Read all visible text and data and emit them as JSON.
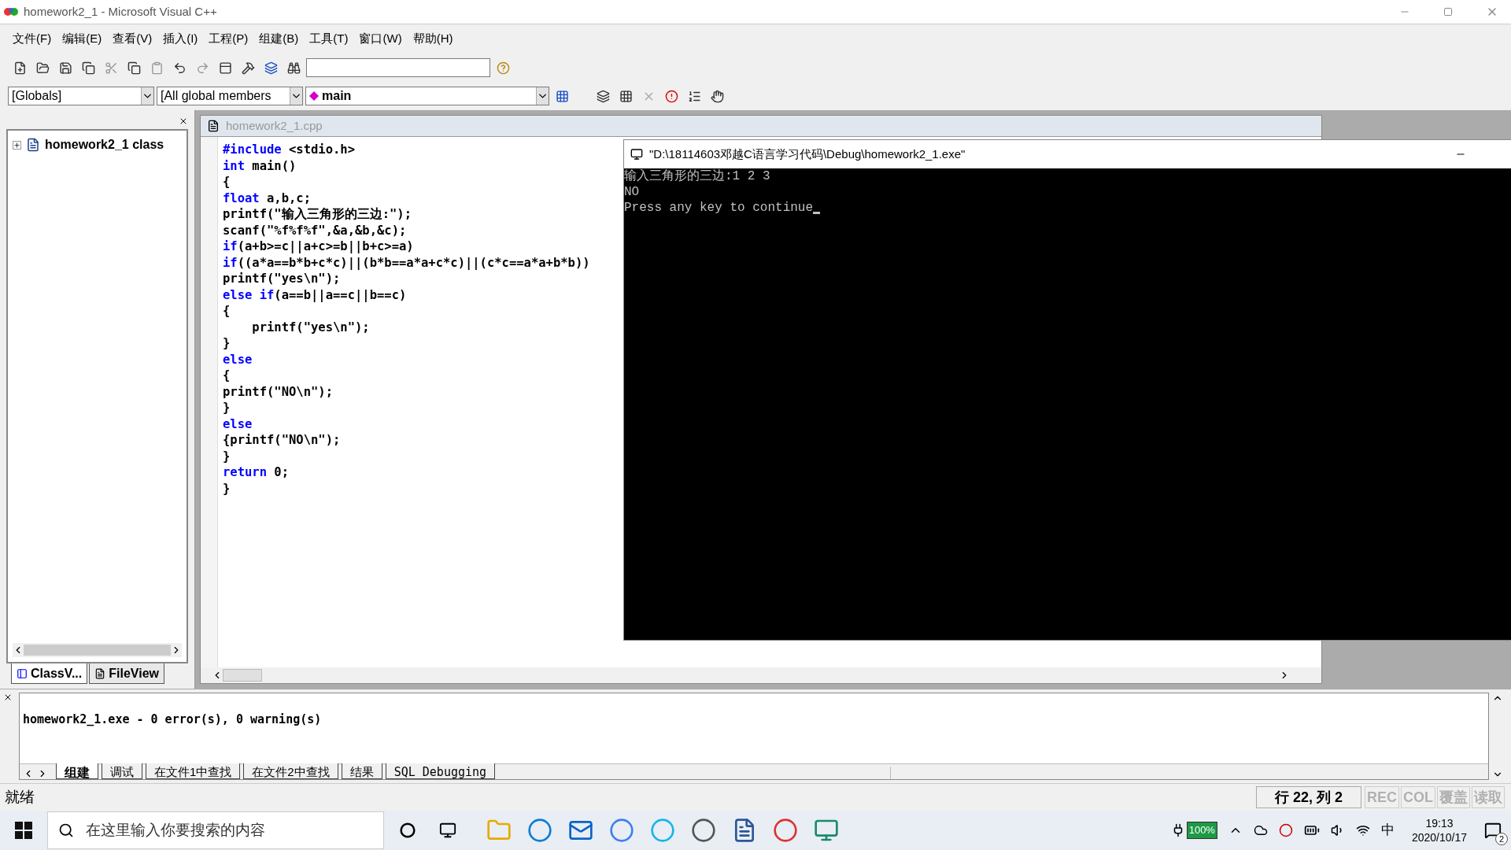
{
  "window": {
    "title": "homework2_1 - Microsoft Visual C++"
  },
  "menu": [
    "文件(F)",
    "编辑(E)",
    "查看(V)",
    "插入(I)",
    "工程(P)",
    "组建(B)",
    "工具(T)",
    "窗口(W)",
    "帮助(H)"
  ],
  "wizard_bar": {
    "class_combo": "[Globals]",
    "filter_combo": "[All global members",
    "member_combo": "main"
  },
  "workspace": {
    "tree": [
      {
        "label": "homework2_1 class",
        "expanded": false
      }
    ],
    "tabs": [
      {
        "label": "ClassV...",
        "selected": true
      },
      {
        "label": "FileView",
        "selected": false
      }
    ]
  },
  "editor": {
    "title": "homework2_1.cpp",
    "lines": [
      [
        {
          "kind": "keyword",
          "text": "#include"
        },
        {
          "kind": "plain",
          "text": " <stdio.h>"
        }
      ],
      [
        {
          "kind": "keyword",
          "text": "int"
        },
        {
          "kind": "plain",
          "text": " main()"
        }
      ],
      [
        {
          "kind": "plain",
          "text": "{"
        }
      ],
      [
        {
          "kind": "keyword",
          "text": "float"
        },
        {
          "kind": "plain",
          "text": " a,b,c;"
        }
      ],
      [
        {
          "kind": "plain",
          "text": "printf(\"输入三角形的三边:\");"
        }
      ],
      [
        {
          "kind": "plain",
          "text": "scanf(\"%f%f%f\",&a,&b,&c);"
        }
      ],
      [
        {
          "kind": "keyword",
          "text": "if"
        },
        {
          "kind": "plain",
          "text": "(a+b>=c||a+c>=b||b+c>=a)"
        }
      ],
      [
        {
          "kind": "keyword",
          "text": "if"
        },
        {
          "kind": "plain",
          "text": "((a*a==b*b+c*c)||(b*b==a*a+c*c)||(c*c==a*a+b*b))"
        }
      ],
      [
        {
          "kind": "plain",
          "text": "printf(\"yes\\n\");"
        }
      ],
      [
        {
          "kind": "keyword",
          "text": "else if"
        },
        {
          "kind": "plain",
          "text": "(a==b||a==c||b==c)"
        }
      ],
      [
        {
          "kind": "plain",
          "text": "{"
        }
      ],
      [
        {
          "kind": "plain",
          "text": "    printf(\"yes\\n\");"
        }
      ],
      [
        {
          "kind": "plain",
          "text": "}"
        }
      ],
      [
        {
          "kind": "keyword",
          "text": "else"
        }
      ],
      [
        {
          "kind": "plain",
          "text": "{"
        }
      ],
      [
        {
          "kind": "plain",
          "text": "printf(\"NO\\n\");"
        }
      ],
      [
        {
          "kind": "plain",
          "text": "}"
        }
      ],
      [
        {
          "kind": "keyword",
          "text": "else"
        }
      ],
      [
        {
          "kind": "plain",
          "text": "{printf(\"NO\\n\");"
        }
      ],
      [
        {
          "kind": "plain",
          "text": "}"
        }
      ],
      [
        {
          "kind": "keyword",
          "text": "return"
        },
        {
          "kind": "plain",
          "text": " 0;"
        }
      ],
      [
        {
          "kind": "plain",
          "text": "}"
        }
      ]
    ]
  },
  "console": {
    "title": "\"D:\\18114603邓越C语言学习代码\\Debug\\homework2_1.exe\"",
    "lines": [
      "输入三角形的三边:1 2 3",
      "NO",
      "Press any key to continue"
    ]
  },
  "output": {
    "lines": [
      "homework2_1.exe - 0 error(s), 0 warning(s)"
    ],
    "tabs": [
      {
        "label": "组建",
        "selected": true
      },
      {
        "label": "调试",
        "selected": false
      },
      {
        "label": "在文件1中查找",
        "selected": false
      },
      {
        "label": "在文件2中查找",
        "selected": false
      },
      {
        "label": "结果",
        "selected": false
      },
      {
        "label": "SQL Debugging",
        "selected": false
      }
    ]
  },
  "status_bar": {
    "message": "就绪",
    "position": "行 22, 列 2",
    "indicators": [
      {
        "label": "REC",
        "disabled": true
      },
      {
        "label": "COL",
        "disabled": true
      },
      {
        "label": "覆盖",
        "disabled": true
      },
      {
        "label": "读取",
        "disabled": true
      }
    ]
  },
  "taskbar": {
    "search": {
      "placeholder": "在这里输入你要搜索的内容"
    },
    "battery": "100%",
    "ime": "中",
    "time": "19:13",
    "date": "2020/10/17",
    "notifications": "2"
  }
}
